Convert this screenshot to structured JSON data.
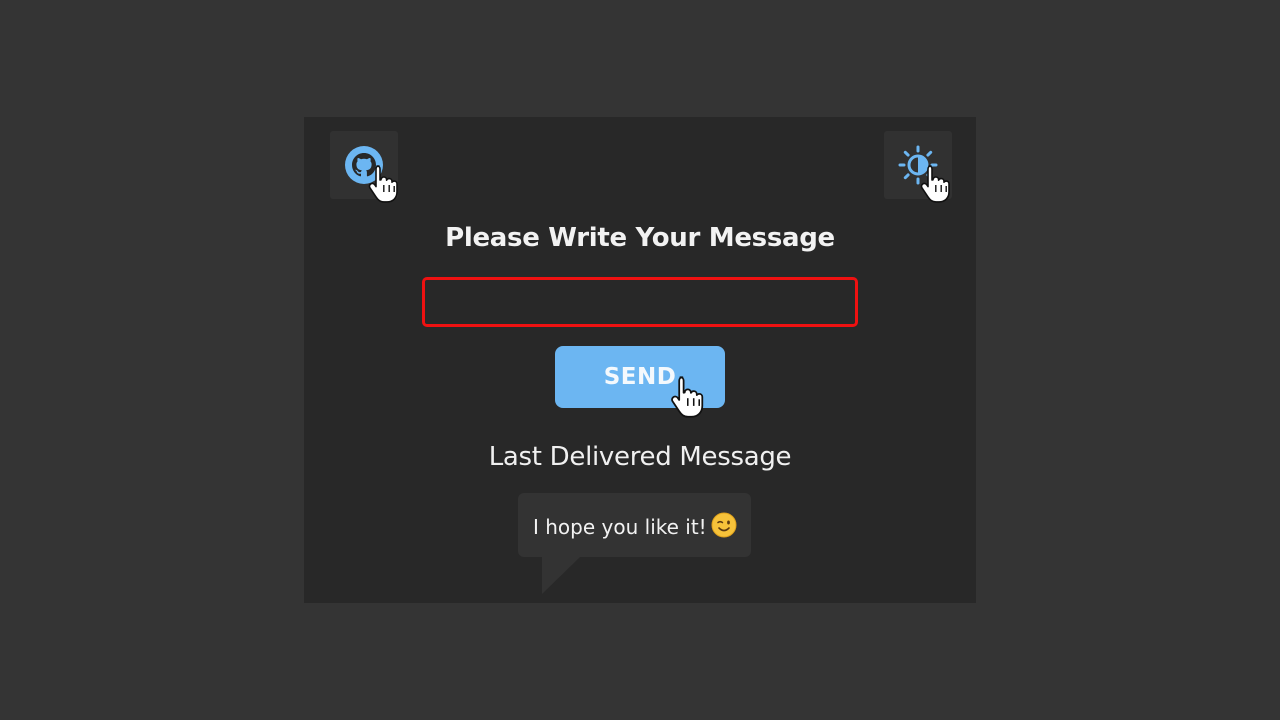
{
  "header": {
    "github_icon": "github-icon",
    "theme_icon": "theme-toggle-icon"
  },
  "form": {
    "title": "Please Write Your Message",
    "input_value": "",
    "input_placeholder": "",
    "send_label": "SEND"
  },
  "last_message": {
    "label": "Last Delivered Message",
    "text": "I hope you like it!",
    "emoji": "smiling-face-with-wink"
  },
  "colors": {
    "page_background": "#343434",
    "card_background": "#282828",
    "accent": "#6cb6f2",
    "input_border_error": "#ee1111",
    "bubble_background": "#333333"
  }
}
